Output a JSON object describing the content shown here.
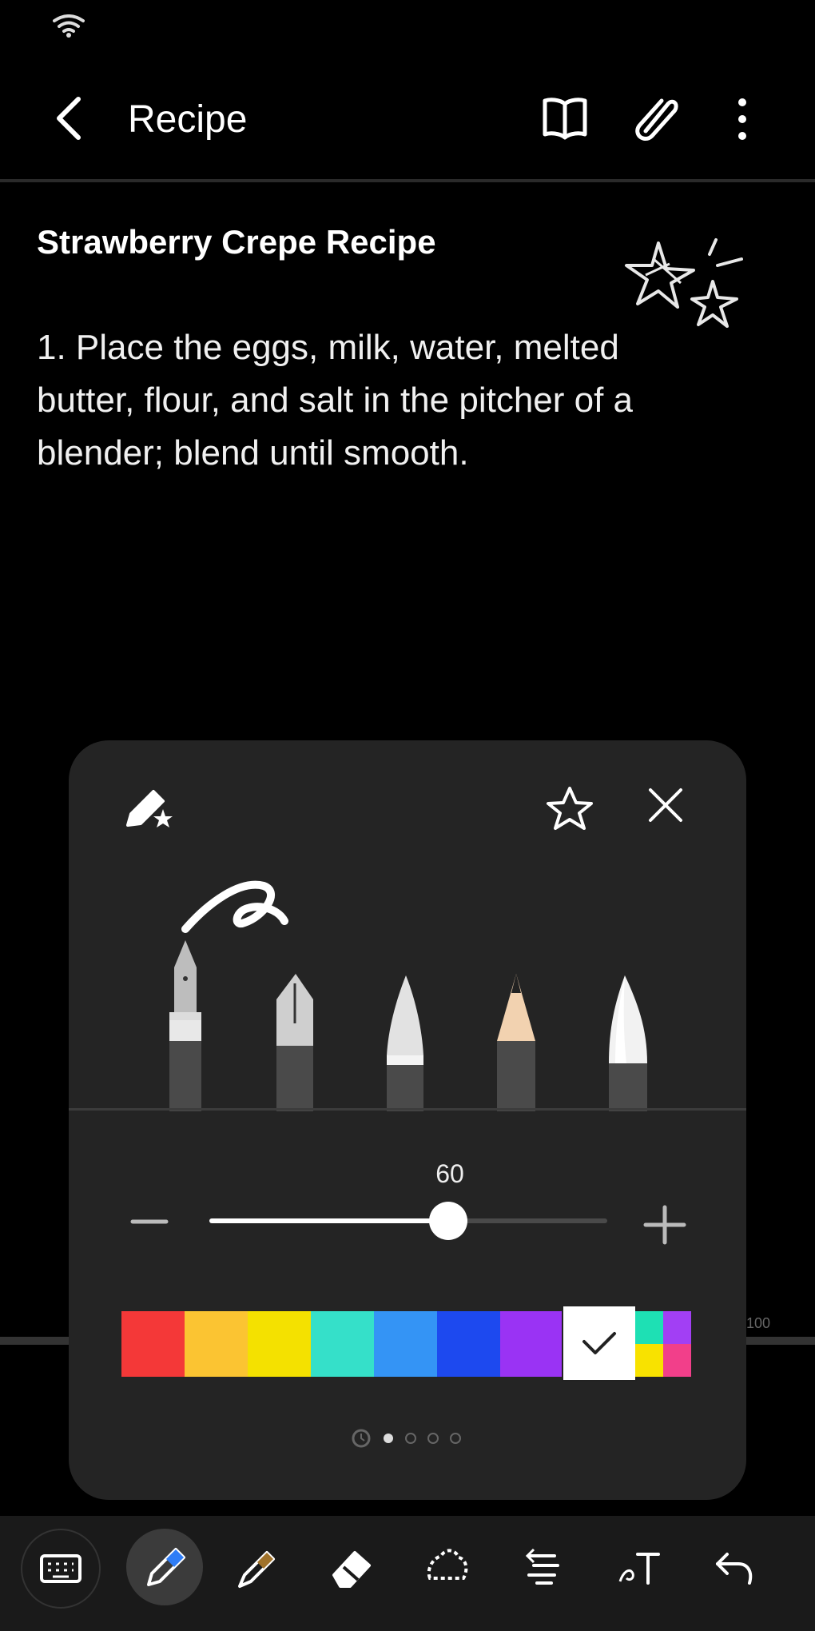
{
  "status_bar": {
    "wifi_icon": "wifi-icon"
  },
  "app_bar": {
    "back_icon": "back-arrow-icon",
    "title": "Recipe",
    "actions": [
      "reading-mode-icon",
      "attach-icon",
      "more-options-icon"
    ]
  },
  "note": {
    "title": "Strawberry Crepe Recipe",
    "body": "1. Place the eggs, milk, water, melted butter, flour, and salt in the pitcher of a blender; blend until smooth.",
    "doodle": "stars-drawing"
  },
  "page_number": "100",
  "pen_settings": {
    "header_icons": [
      "pen-settings-icon",
      "favorite-star-icon",
      "close-icon"
    ],
    "pen_types": [
      "fountain-pen",
      "calligraphy-pen",
      "brush-pen",
      "pencil",
      "marker"
    ],
    "selected_pen": "fountain-pen",
    "size": {
      "value": "60",
      "fraction": 0.6,
      "minus_icon": "minus-icon",
      "plus_icon": "plus-icon"
    },
    "colors": [
      "#f43838",
      "#fbc432",
      "#f4e100",
      "#35e0c9",
      "#3494f5",
      "#1d49ef",
      "#9a33f4",
      "#ffffff"
    ],
    "selected_color": "#ffffff",
    "extra_colors": [
      "#1ee0b4",
      "#a23ff4",
      "#f8e200",
      "#f23f8a"
    ],
    "pages": {
      "count": 4,
      "current": 0
    }
  },
  "toolbar": {
    "tools": [
      "keyboard-icon",
      "pen-icon",
      "highlighter-icon",
      "eraser-icon",
      "lasso-icon",
      "text-align-icon",
      "text-style-icon",
      "undo-icon"
    ],
    "active_tool": "pen-icon",
    "colors": {
      "accent": "#2f7df6"
    }
  }
}
